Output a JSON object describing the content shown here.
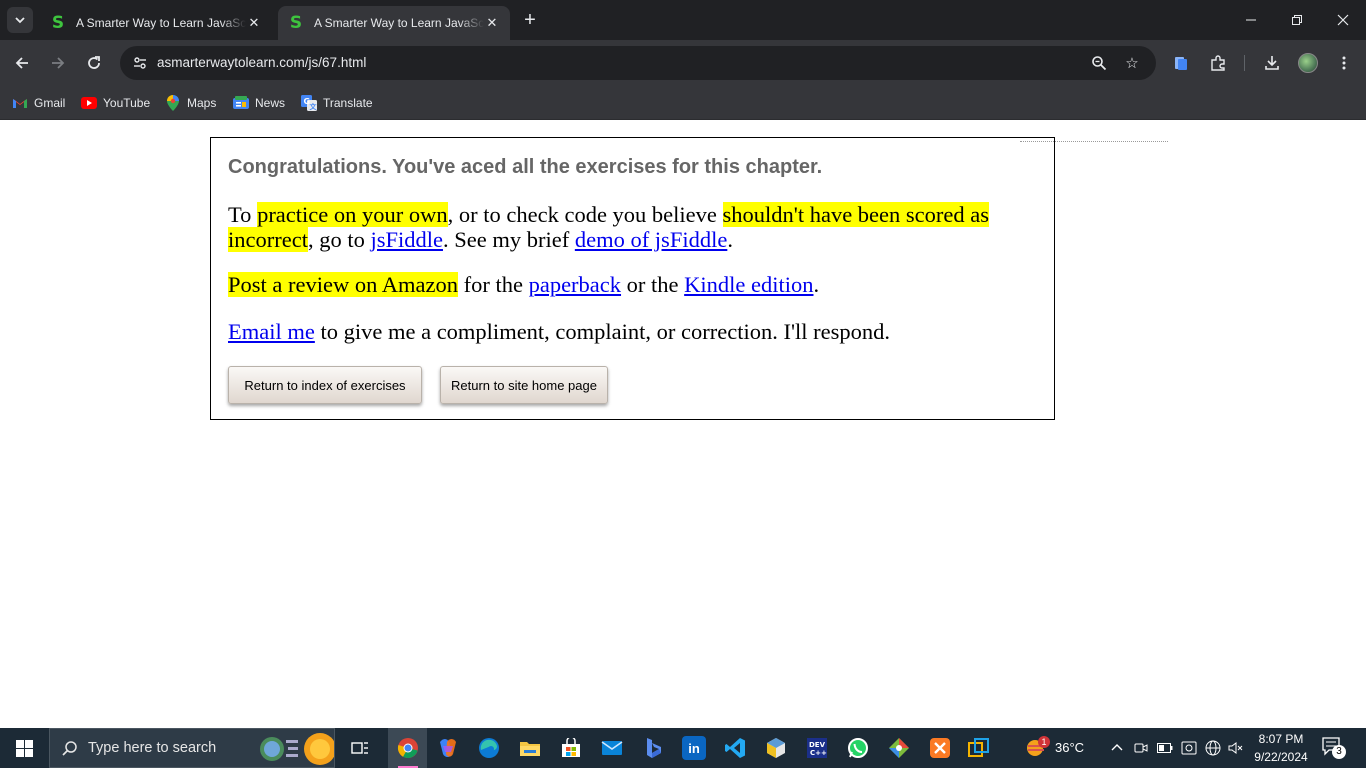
{
  "browser": {
    "tabs": [
      {
        "title": "A Smarter Way to Learn JavaScript",
        "favicon": "S"
      },
      {
        "title": "A Smarter Way to Learn JavaScript",
        "favicon": "S"
      }
    ],
    "url": "asmarterwaytolearn.com/js/67.html",
    "bookmarks": [
      {
        "label": "Gmail",
        "icon": "gmail-icon"
      },
      {
        "label": "YouTube",
        "icon": "youtube-icon"
      },
      {
        "label": "Maps",
        "icon": "maps-icon"
      },
      {
        "label": "News",
        "icon": "news-icon"
      },
      {
        "label": "Translate",
        "icon": "translate-icon"
      }
    ]
  },
  "page": {
    "heading": "Congratulations. You've aced all the exercises for this chapter.",
    "p1": {
      "t1": "To ",
      "h1": "practice on your own",
      "t2": ", or to check code you believe ",
      "h2": "shouldn't have been scored as incorrect",
      "t3": ", go to ",
      "l1": "jsFiddle",
      "t4": ". See my brief ",
      "l2": "demo of jsFiddle",
      "t5": "."
    },
    "p2": {
      "h1": "Post a review on Amazon",
      "t1": " for the ",
      "l1": "paperback",
      "t2": " or the ",
      "l2": "Kindle edition",
      "t3": "."
    },
    "p3": {
      "l1": "Email me",
      "t1": " to give me a compliment, complaint, or correction. I'll respond."
    },
    "buttons": {
      "index": "Return to index of exercises",
      "home": "Return to site home page"
    },
    "highlight_color": "#ffff00",
    "link_color": "#0000ee"
  },
  "taskbar": {
    "search_placeholder": "Type here to search",
    "weather": "36°C",
    "weather_badge": "1",
    "time": "8:07 PM",
    "date": "9/22/2024",
    "notifications": "3"
  }
}
